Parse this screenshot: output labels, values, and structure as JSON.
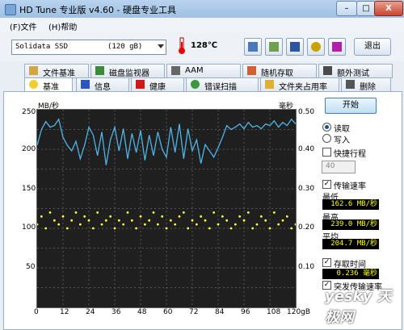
{
  "window": {
    "title": "HD Tune 专业版 v4.60 - 硬盘专业工具",
    "min": "–",
    "max": "□",
    "close": "X"
  },
  "menu": [
    "(F)文件",
    "(H)帮助"
  ],
  "toolbar": {
    "drive": "Solidata  SSD",
    "capacity": "(120 gB)",
    "temperature": "128℃",
    "exit_label": "退出"
  },
  "tabs_row1": [
    "文件基准",
    "磁盘监视器",
    "AAM",
    "随机存取",
    "额外测试"
  ],
  "tabs_row2": [
    "基准",
    "信息",
    "健康",
    "错误扫描",
    "文件夹占用率",
    "删除"
  ],
  "chart": {
    "left_unit": "MB/秒",
    "right_unit": "毫秒",
    "left_ticks": [
      "250",
      "200",
      "150",
      "100",
      "50"
    ],
    "right_ticks": [
      "0.50",
      "0.40",
      "0.30",
      "0.20",
      "0.10"
    ],
    "x_ticks": [
      "0",
      "12",
      "24",
      "36",
      "48",
      "60",
      "72",
      "84",
      "96",
      "108",
      "120gB"
    ]
  },
  "controls": {
    "start": "开始",
    "read": "读取",
    "write": "写入",
    "fast_mode": "快捷行程",
    "spin_value": "40",
    "transfer_rate": "传输速率",
    "min_label": "最低",
    "min_value": "162.6 MB/秒",
    "max_label": "最高",
    "max_value": "239.0 MB/秒",
    "avg_label": "平均",
    "avg_value": "204.7 MB/秒",
    "access_time": "存取时间",
    "access_value": "0.236 毫秒",
    "burst_rate": "突发传输速率",
    "check_mark": "✓"
  },
  "watermark": "yesky 天极网",
  "chart_data": {
    "type": "line",
    "x": [
      0,
      2,
      4,
      6,
      8,
      10,
      12,
      14,
      16,
      18,
      20,
      22,
      24,
      26,
      28,
      30,
      32,
      34,
      36,
      38,
      40,
      42,
      44,
      46,
      48,
      50,
      52,
      54,
      56,
      58,
      60,
      62,
      64,
      66,
      68,
      70,
      72,
      74,
      76,
      78,
      80,
      82,
      84,
      86,
      88,
      90,
      92,
      94,
      96,
      98,
      100,
      102,
      104,
      106,
      108,
      110,
      112,
      114,
      116,
      118,
      120
    ],
    "series": [
      {
        "values": [
          205,
          225,
          235,
          228,
          230,
          238,
          215,
          205,
          198,
          210,
          188,
          205,
          228,
          218,
          192,
          222,
          180,
          212,
          228,
          198,
          226,
          188,
          220,
          196,
          224,
          186,
          218,
          192,
          222,
          200,
          190,
          228,
          196,
          232,
          188,
          226,
          198,
          212,
          182,
          206,
          198,
          190,
          202,
          215,
          230,
          225,
          228,
          232,
          226,
          234,
          228,
          230,
          226,
          232,
          230,
          236,
          228,
          234,
          230,
          238,
          232
        ]
      },
      {
        "values": [
          0.21,
          0.23,
          0.2,
          0.24,
          0.22,
          0.21,
          0.23,
          0.2,
          0.22,
          0.24,
          0.21,
          0.23,
          0.22,
          0.2,
          0.24,
          0.21,
          0.22,
          0.23,
          0.2,
          0.22,
          0.21,
          0.24,
          0.22,
          0.2,
          0.23,
          0.21,
          0.22,
          0.24,
          0.21,
          0.23,
          0.2,
          0.22,
          0.21,
          0.23,
          0.24,
          0.2,
          0.22,
          0.21,
          0.23,
          0.22,
          0.2,
          0.24,
          0.21,
          0.23,
          0.22,
          0.2,
          0.21,
          0.23,
          0.22,
          0.24,
          0.2,
          0.21,
          0.23,
          0.22,
          0.2,
          0.24,
          0.21,
          0.22,
          0.23,
          0.2,
          0.21
        ]
      }
    ],
    "ylim_left": [
      0,
      250
    ],
    "ylim_right": [
      0,
      0.5
    ],
    "xlim": [
      0,
      120
    ],
    "grid": true
  }
}
